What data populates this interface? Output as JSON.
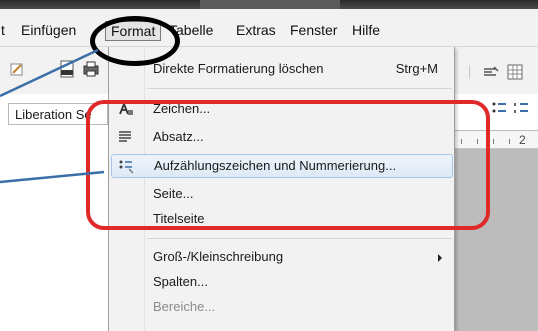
{
  "menubar": {
    "items": [
      {
        "label": "t"
      },
      {
        "label": "Einfügen"
      },
      {
        "label": "Format"
      },
      {
        "label": "Tabelle"
      },
      {
        "label": "Extras"
      },
      {
        "label": "Fenster"
      },
      {
        "label": "Hilfe"
      }
    ]
  },
  "toolbar": {
    "font_name": "Liberation Se"
  },
  "ruler": {
    "number": "2"
  },
  "format_menu": {
    "direct_formatting": {
      "label": "Direkte Formatierung löschen",
      "shortcut": "Strg+M"
    },
    "character": {
      "label": "Zeichen..."
    },
    "paragraph": {
      "label": "Absatz..."
    },
    "bullets": {
      "label": "Aufzählungszeichen und Nummerierung..."
    },
    "page": {
      "label": "Seite..."
    },
    "title_page": {
      "label": "Titelseite"
    },
    "case": {
      "label": "Groß-/Kleinschreibung"
    },
    "columns": {
      "label": "Spalten..."
    },
    "sections": {
      "label": "Bereiche..."
    }
  },
  "colors": {
    "annotation_red": "#e02a2a",
    "annotation_blue": "#3a6fa8",
    "highlight_border": "#a9c6e8"
  }
}
